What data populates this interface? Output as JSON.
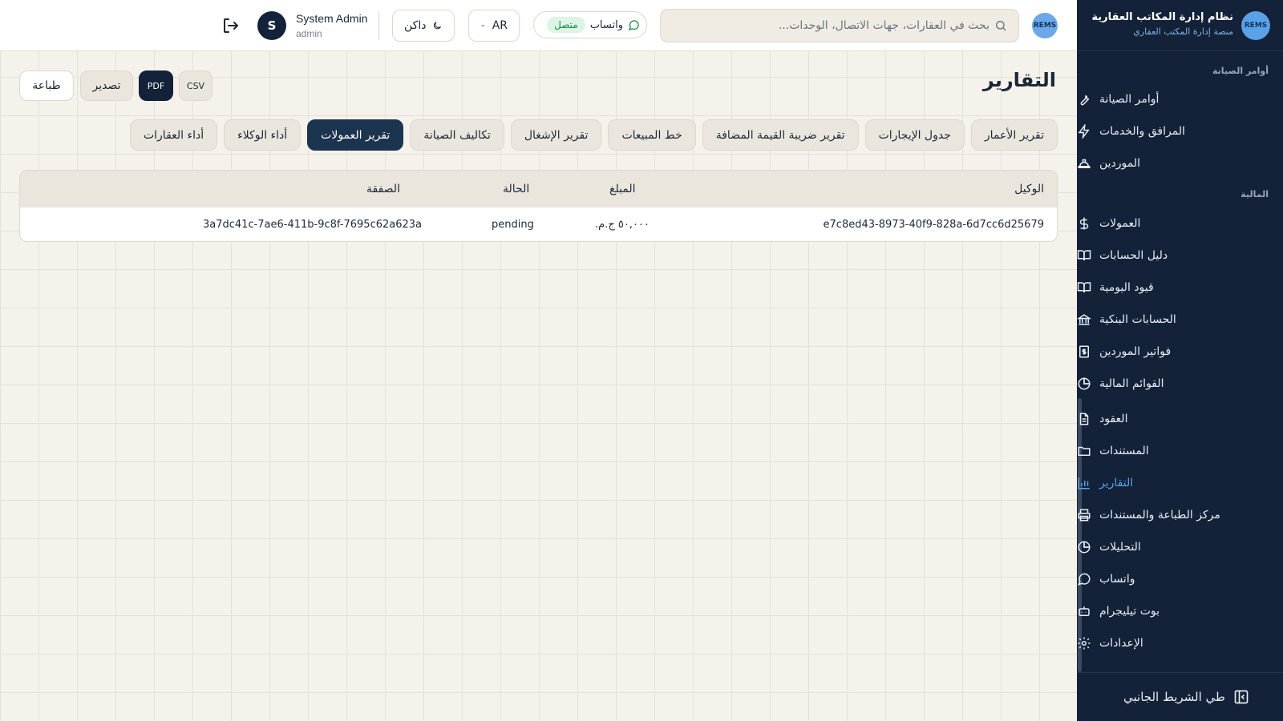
{
  "header": {
    "search_placeholder": "بحث في العقارات، جهات الاتصال، الوحدات...",
    "whatsapp_label": "واتساب",
    "whatsapp_status": "متصل",
    "language": "AR",
    "theme_label": "داكن",
    "user_initial": "S",
    "user_name": "System Admin",
    "user_role": "admin",
    "logo_text": "REMS"
  },
  "page": {
    "title": "التقارير",
    "print_label": "طباعة",
    "export_label": "تصدير",
    "pdf_label": "PDF",
    "csv_label": "CSV"
  },
  "tabs": [
    {
      "label": "تقرير الأعمار"
    },
    {
      "label": "جدول الإيجارات"
    },
    {
      "label": "تقرير ضريبة القيمة المضافة"
    },
    {
      "label": "خط المبيعات"
    },
    {
      "label": "تقرير الإشغال"
    },
    {
      "label": "تكاليف الصيانة"
    },
    {
      "label": "تقرير العمولات"
    },
    {
      "label": "أداء الوكلاء"
    },
    {
      "label": "أداء العقارات"
    }
  ],
  "active_tab": "تقرير العمولات",
  "table": {
    "headers": {
      "agent": "الوكيل",
      "amount": "المبلغ",
      "status": "الحالة",
      "deal": "الصفقة"
    },
    "rows": [
      {
        "agent": "e7c8ed43-8973-40f9-828a-6d7cc6d25679",
        "amount": "٥٠,٠٠٠ ج.م.",
        "status": "pending",
        "deal": "3a7dc41c-7ae6-411b-9c8f-7695c62a623a"
      }
    ]
  },
  "sidebar": {
    "brand_title": "نظام إدارة المكاتب العقارية",
    "brand_subtitle": "منصة إدارة المكتب العقاري",
    "logo_text": "REMS",
    "section_maintenance": "أوامر الصيانة",
    "section_finance": "المالية",
    "items": [
      {
        "label": "أوامر الصيانة",
        "icon": "wrench-icon"
      },
      {
        "label": "المرافق والخدمات",
        "icon": "lightning-icon"
      },
      {
        "label": "الموردين",
        "icon": "helmet-icon"
      },
      {
        "label": "العمولات",
        "icon": "dollar-icon"
      },
      {
        "label": "دليل الحسابات",
        "icon": "book-icon"
      },
      {
        "label": "قيود اليومية",
        "icon": "book-open-icon"
      },
      {
        "label": "الحسابات البنكية",
        "icon": "bank-icon"
      },
      {
        "label": "فواتير الموردين",
        "icon": "invoice-icon"
      },
      {
        "label": "القوائم المالية",
        "icon": "pie-chart-icon"
      },
      {
        "label": "العقود",
        "icon": "document-icon"
      },
      {
        "label": "المستندات",
        "icon": "folder-icon"
      },
      {
        "label": "التقارير",
        "icon": "bar-chart-icon"
      },
      {
        "label": "مركز الطباعة والمستندات",
        "icon": "printer-icon"
      },
      {
        "label": "التحليلات",
        "icon": "analytics-icon"
      },
      {
        "label": "واتساب",
        "icon": "chat-icon"
      },
      {
        "label": "بوت تيليجرام",
        "icon": "bot-icon"
      },
      {
        "label": "الإعدادات",
        "icon": "gear-icon"
      }
    ],
    "active_item": "التقارير",
    "collapse_label": "طي الشريط الجانبي"
  },
  "colors": {
    "sidebar_bg": "#132238",
    "accent": "#5aa2e8",
    "active_tab_bg": "#1b3450",
    "status_green": "#168a49"
  }
}
